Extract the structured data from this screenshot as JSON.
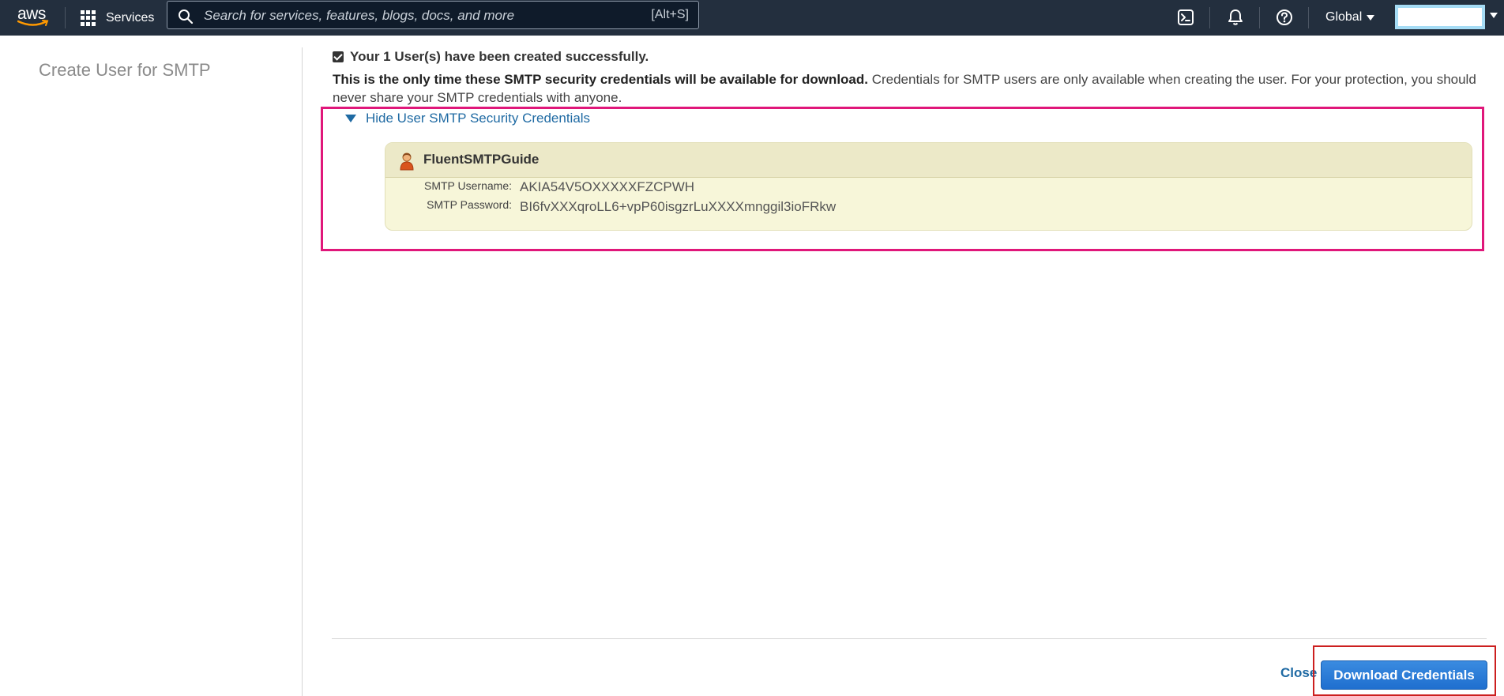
{
  "topnav": {
    "logo_text": "aws",
    "services_label": "Services",
    "search_placeholder": "Search for services, features, blogs, docs, and more",
    "search_shortcut": "[Alt+S]",
    "region_label": "Global",
    "icons": [
      "cloudshell-icon",
      "bell-icon",
      "help-icon"
    ]
  },
  "page": {
    "title": "Create User for SMTP"
  },
  "content": {
    "success_message": "Your 1 User(s) have been created successfully.",
    "notice_bold": "This is the only time these SMTP security credentials will be available for download.",
    "notice_rest": " Credentials for SMTP users are only available when creating the user. For your protection, you should never share your SMTP credentials with anyone.",
    "toggle_label": "Hide User SMTP Security Credentials",
    "credentials": {
      "user_name": "FluentSMTPGuide",
      "username_label": "SMTP Username:",
      "username_value": "AKIA54V5OXXXXXFZCPWH",
      "password_label": "SMTP Password:",
      "password_value": "BI6fvXXXqroLL6+vpP60isgzrLuXXXXmnggil3ioFRkw"
    }
  },
  "footer": {
    "close_label": "Close",
    "download_label": "Download Credentials"
  },
  "colors": {
    "nav_bg": "#232f3e",
    "link": "#1f6aa3",
    "highlight_pink": "#e0177a",
    "highlight_red": "#cc1f1f",
    "primary_button": "#1f6fcf"
  }
}
